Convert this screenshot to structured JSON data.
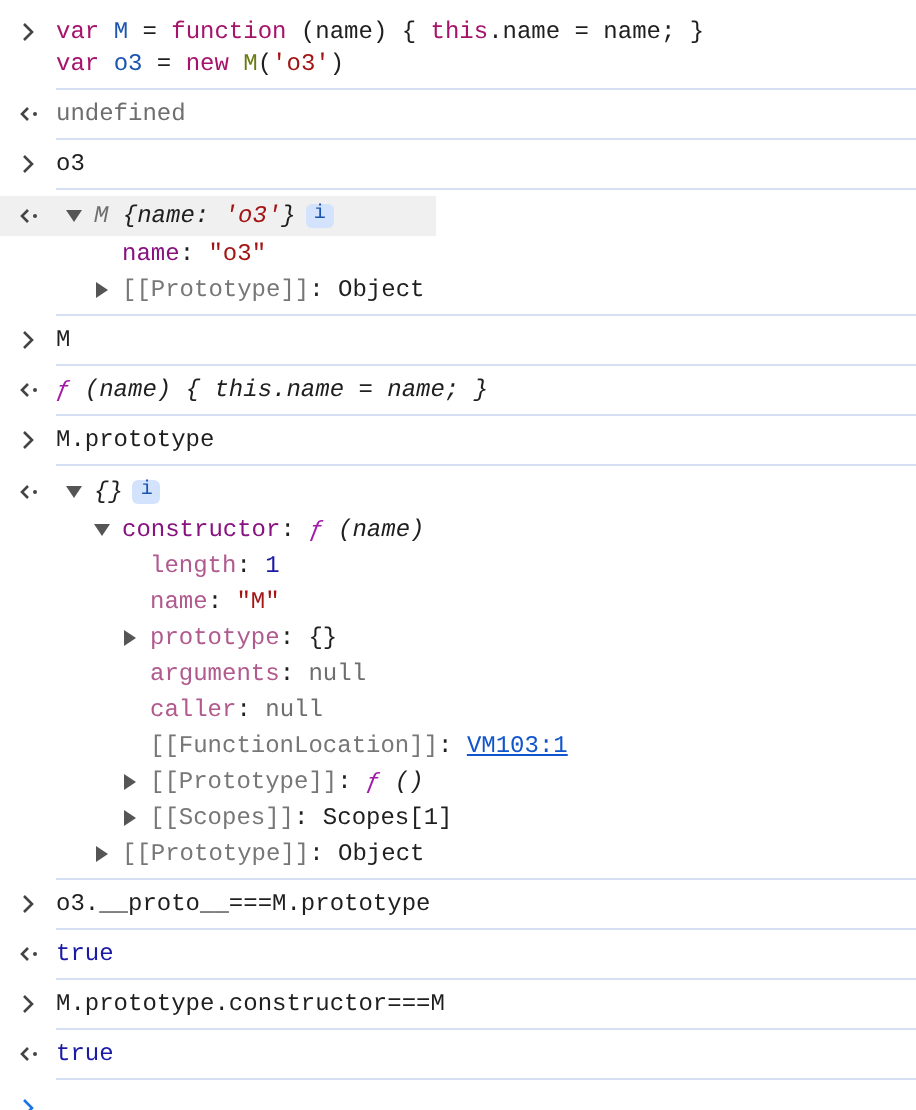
{
  "console": {
    "entries": [
      {
        "kind": "input",
        "lines": [
          [
            {
              "text": "var ",
              "kind": "keyword"
            },
            {
              "text": "M",
              "kind": "variable"
            },
            {
              "text": " = ",
              "kind": "plain"
            },
            {
              "text": "function",
              "kind": "keyword"
            },
            {
              "text": " (name) { ",
              "kind": "plain"
            },
            {
              "text": "this",
              "kind": "keyword"
            },
            {
              "text": ".name = name; }",
              "kind": "plain"
            }
          ],
          [
            {
              "text": "var ",
              "kind": "keyword"
            },
            {
              "text": "o3",
              "kind": "variable"
            },
            {
              "text": " = ",
              "kind": "plain"
            },
            {
              "text": "new ",
              "kind": "keyword"
            },
            {
              "text": "M",
              "kind": "call"
            },
            {
              "text": "(",
              "kind": "plain"
            },
            {
              "text": "'o3'",
              "kind": "string"
            },
            {
              "text": ")",
              "kind": "plain"
            }
          ]
        ]
      },
      {
        "kind": "output",
        "lines": [
          [
            {
              "text": "undefined",
              "kind": "dim"
            }
          ]
        ]
      },
      {
        "kind": "input",
        "lines": [
          [
            {
              "text": "o3",
              "kind": "plain"
            }
          ]
        ]
      },
      {
        "kind": "tree",
        "root": {
          "summary": [
            {
              "text": "M ",
              "kind": "dim"
            },
            {
              "text": "{name: ",
              "kind": "plain"
            },
            {
              "text": "'o3'",
              "kind": "string"
            },
            {
              "text": "}",
              "kind": "plain"
            }
          ],
          "badge": "i",
          "highlighted": true,
          "expanded": true,
          "children": [
            {
              "line": [
                {
                  "text": "name",
                  "kind": "key"
                },
                {
                  "text": ": ",
                  "kind": "plain"
                },
                {
                  "text": "\"o3\"",
                  "kind": "string"
                }
              ]
            },
            {
              "line": [
                {
                  "text": "[[Prototype]]",
                  "kind": "internal"
                },
                {
                  "text": ": Object",
                  "kind": "plain"
                }
              ],
              "expanded": false
            }
          ]
        }
      },
      {
        "kind": "input",
        "lines": [
          [
            {
              "text": "M",
              "kind": "plain"
            }
          ]
        ]
      },
      {
        "kind": "output",
        "lines": [
          [
            {
              "text": "ƒ",
              "kind": "function"
            },
            {
              "text": " (name) { this.name = name; }",
              "kind": "italic"
            }
          ]
        ]
      },
      {
        "kind": "input",
        "lines": [
          [
            {
              "text": "M.prototype",
              "kind": "plain"
            }
          ]
        ]
      },
      {
        "kind": "tree",
        "root": {
          "summary": [
            {
              "text": "{}",
              "kind": "plain"
            }
          ],
          "badge": "i",
          "highlighted": false,
          "expanded": true,
          "children": [
            {
              "line": [
                {
                  "text": "constructor",
                  "kind": "key"
                },
                {
                  "text": ": ",
                  "kind": "plain"
                },
                {
                  "text": "ƒ",
                  "kind": "function"
                },
                {
                  "text": " (name)",
                  "kind": "italic"
                }
              ],
              "expanded": true,
              "children": [
                {
                  "line": [
                    {
                      "text": "length",
                      "kind": "faint"
                    },
                    {
                      "text": ": ",
                      "kind": "plain"
                    },
                    {
                      "text": "1",
                      "kind": "number"
                    }
                  ]
                },
                {
                  "line": [
                    {
                      "text": "name",
                      "kind": "faint"
                    },
                    {
                      "text": ": ",
                      "kind": "plain"
                    },
                    {
                      "text": "\"M\"",
                      "kind": "string"
                    }
                  ]
                },
                {
                  "line": [
                    {
                      "text": "prototype",
                      "kind": "faint"
                    },
                    {
                      "text": ": {}",
                      "kind": "plain"
                    }
                  ],
                  "expanded": false
                },
                {
                  "line": [
                    {
                      "text": "arguments",
                      "kind": "faint"
                    },
                    {
                      "text": ": ",
                      "kind": "plain"
                    },
                    {
                      "text": "null",
                      "kind": "dim"
                    }
                  ]
                },
                {
                  "line": [
                    {
                      "text": "caller",
                      "kind": "faint"
                    },
                    {
                      "text": ": ",
                      "kind": "plain"
                    },
                    {
                      "text": "null",
                      "kind": "dim"
                    }
                  ]
                },
                {
                  "line": [
                    {
                      "text": "[[FunctionLocation]]",
                      "kind": "internal"
                    },
                    {
                      "text": ": ",
                      "kind": "plain"
                    },
                    {
                      "text": "VM103:1",
                      "kind": "link"
                    }
                  ]
                },
                {
                  "line": [
                    {
                      "text": "[[Prototype]]",
                      "kind": "internal"
                    },
                    {
                      "text": ": ",
                      "kind": "plain"
                    },
                    {
                      "text": "ƒ",
                      "kind": "function"
                    },
                    {
                      "text": " ()",
                      "kind": "italic"
                    }
                  ],
                  "expanded": false
                },
                {
                  "line": [
                    {
                      "text": "[[Scopes]]",
                      "kind": "internal"
                    },
                    {
                      "text": ": Scopes[1]",
                      "kind": "plain"
                    }
                  ],
                  "expanded": false
                }
              ]
            },
            {
              "line": [
                {
                  "text": "[[Prototype]]",
                  "kind": "internal"
                },
                {
                  "text": ": Object",
                  "kind": "plain"
                }
              ],
              "expanded": false
            }
          ]
        }
      },
      {
        "kind": "input",
        "lines": [
          [
            {
              "text": "o3.__proto__===M.prototype",
              "kind": "plain"
            }
          ]
        ]
      },
      {
        "kind": "output",
        "lines": [
          [
            {
              "text": "true",
              "kind": "number"
            }
          ]
        ]
      },
      {
        "kind": "input",
        "lines": [
          [
            {
              "text": "M.prototype.constructor===M",
              "kind": "plain"
            }
          ]
        ]
      },
      {
        "kind": "output",
        "lines": [
          [
            {
              "text": "true",
              "kind": "number"
            }
          ]
        ]
      }
    ]
  }
}
